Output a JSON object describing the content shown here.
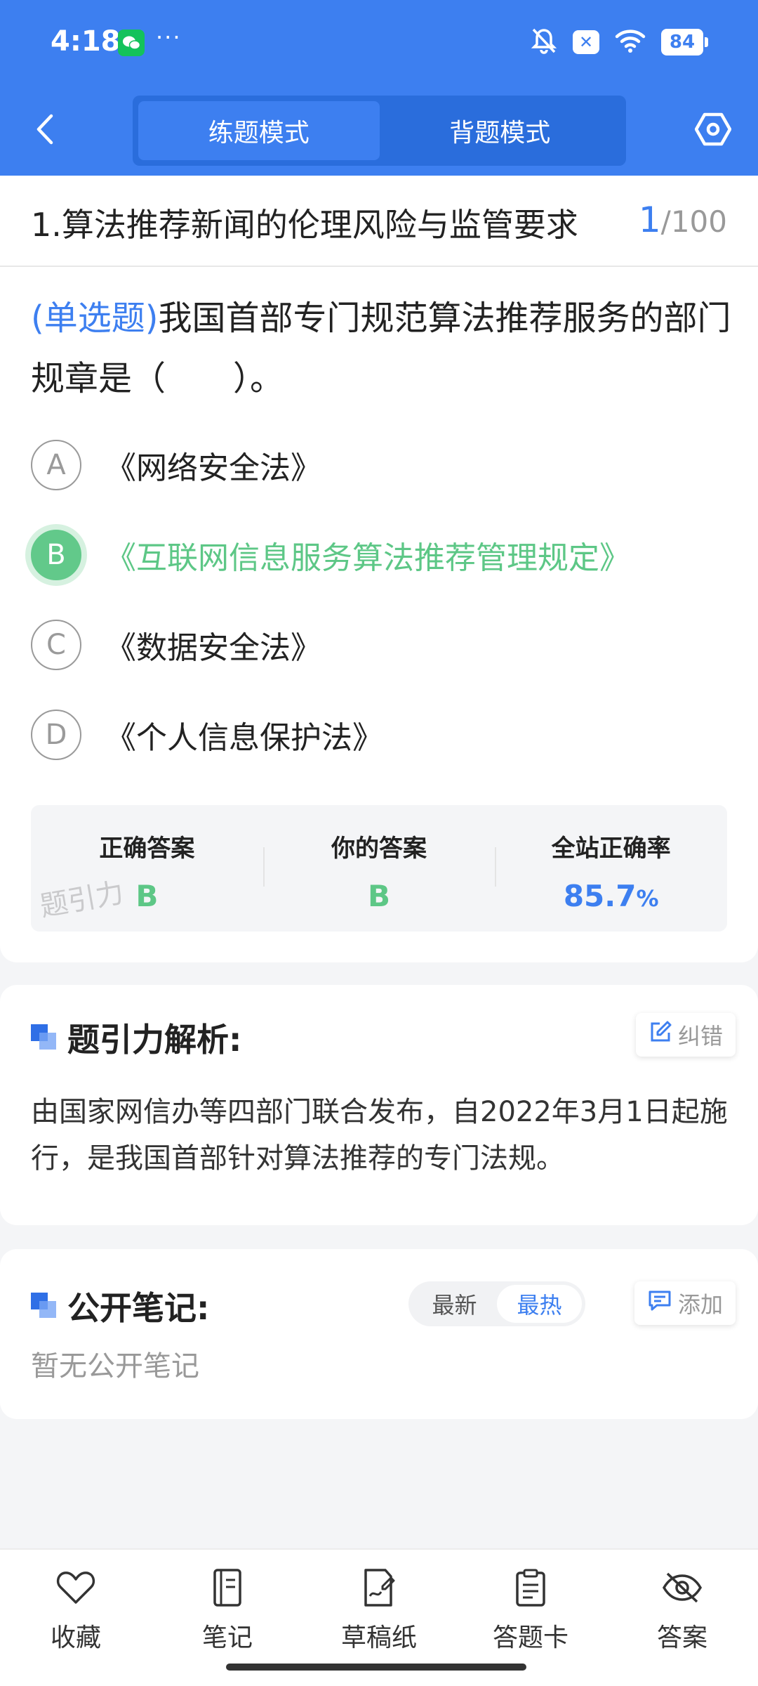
{
  "status_bar": {
    "time": "4:18",
    "dots": "···",
    "battery": "84",
    "notif_badge": "✕"
  },
  "header": {
    "tabs": [
      {
        "label": "练题模式",
        "active": true
      },
      {
        "label": "背题模式",
        "active": false
      }
    ]
  },
  "question_header": {
    "title": "1.算法推荐新闻的伦理风险与监管要求",
    "current": "1",
    "total": "/100"
  },
  "question": {
    "type": "(单选题)",
    "text": "我国首部专门规范算法推荐服务的部门规章是（　　）。",
    "options": [
      {
        "letter": "A",
        "text": "《网络安全法》",
        "state": "normal"
      },
      {
        "letter": "B",
        "text": "《互联网信息服务算法推荐管理规定》",
        "state": "correct"
      },
      {
        "letter": "C",
        "text": "《数据安全法》",
        "state": "normal"
      },
      {
        "letter": "D",
        "text": "《个人信息保护法》",
        "state": "normal"
      }
    ]
  },
  "answer_summary": {
    "correct_label": "正确答案",
    "correct_value": "B",
    "yours_label": "你的答案",
    "yours_value": "B",
    "rate_label": "全站正确率",
    "rate_value": "85.7",
    "rate_unit": "%",
    "watermark": "题引力"
  },
  "analysis": {
    "title": "题引力解析:",
    "report_label": "纠错",
    "text": "由国家网信办等四部门联合发布，自2022年3月1日起施行，是我国首部针对算法推荐的专门法规。"
  },
  "notes": {
    "title": "公开笔记:",
    "sort_options": [
      {
        "label": "最新",
        "active": false
      },
      {
        "label": "最热",
        "active": true
      }
    ],
    "add_label": "添加",
    "empty_text": "暂无公开笔记"
  },
  "bottom_bar": [
    {
      "label": "收藏",
      "icon": "heart-icon"
    },
    {
      "label": "笔记",
      "icon": "notebook-icon"
    },
    {
      "label": "草稿纸",
      "icon": "draft-icon"
    },
    {
      "label": "答题卡",
      "icon": "clipboard-icon"
    },
    {
      "label": "答案",
      "icon": "eye-off-icon"
    }
  ],
  "colors": {
    "primary": "#3d7ff0",
    "correct": "#5dc786",
    "muted": "#999999"
  }
}
